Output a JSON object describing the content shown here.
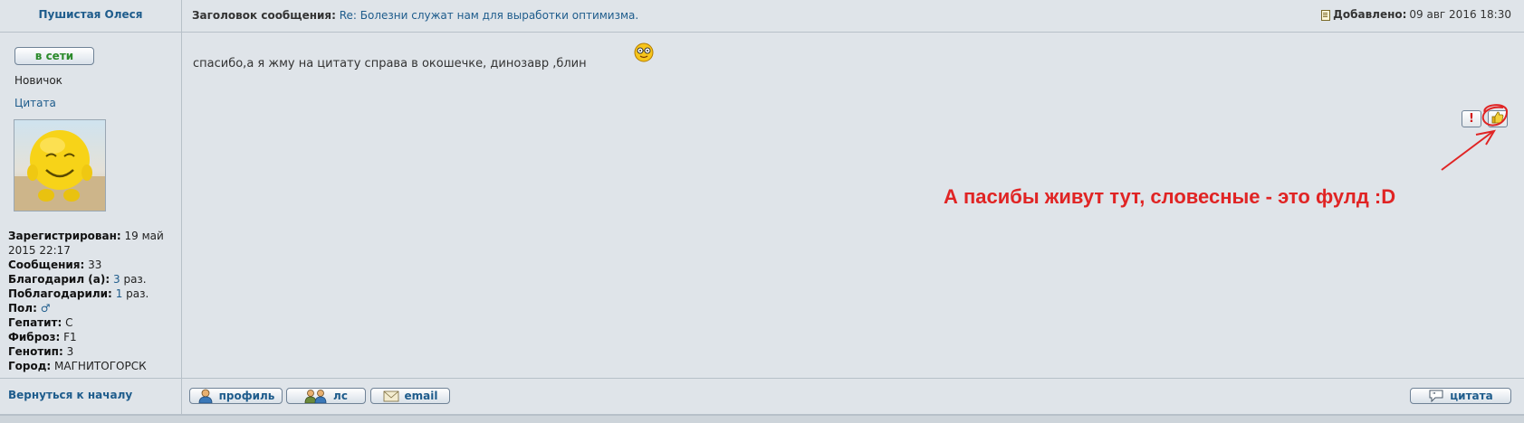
{
  "post_header": {
    "author": "Пушистая Олеся",
    "subject_label": "Заголовок сообщения:",
    "subject_value": "Re: Болезни служат нам для выработки оптимизма.",
    "added_label": "Добавлено:",
    "added_value": "09 авг 2016 18:30"
  },
  "user": {
    "status_button": "в сети",
    "rank": "Новичок",
    "quote_link": "Цитата",
    "profile": [
      {
        "label": "Зарегистрирован:",
        "value": "19 май 2015 22:17",
        "value_color": "text"
      },
      {
        "label": "Сообщения:",
        "value": "33",
        "value_color": "text"
      },
      {
        "label": "Благодарил (а):",
        "value": "3",
        "suffix": " раз.",
        "value_color": "link"
      },
      {
        "label": "Поблагодарили:",
        "value": "1",
        "suffix": " раз.",
        "value_color": "link"
      },
      {
        "label": "Пол:",
        "value": "♂",
        "value_color": "link"
      },
      {
        "label": "Гепатит:",
        "value": "C",
        "value_color": "text"
      },
      {
        "label": "Фиброз:",
        "value": "F1",
        "value_color": "text"
      },
      {
        "label": "Генотип:",
        "value": "3",
        "value_color": "text"
      },
      {
        "label": "Город:",
        "value": "МАГНИТОГОРСК",
        "value_color": "text"
      }
    ]
  },
  "message": {
    "text": "спасибо,а я жму на цитату справа в окошечке, динозавр ,блин",
    "smiley_icon": "nerd-smiley-icon",
    "report_label": "!",
    "annotation": "А пасибы живут тут, словесные - это фулд   :D",
    "annotation_color": "#e02424"
  },
  "footer": {
    "back_to_top": "Вернуться к началу",
    "buttons": {
      "profile": "профиль",
      "pm": "лс",
      "email": "email",
      "quote": "цитата"
    }
  },
  "colors": {
    "link": "#1e5c8c",
    "background": "#dfe4e9",
    "online": "#2b8a2b"
  }
}
